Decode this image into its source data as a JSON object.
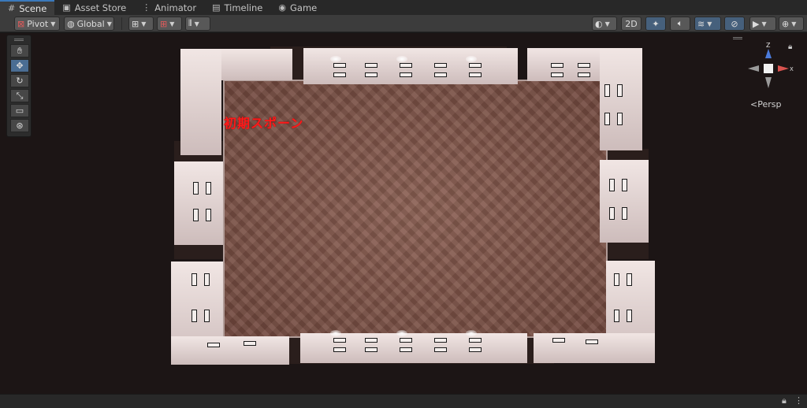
{
  "tabs": [
    {
      "label": "Scene",
      "icon": "grid-icon",
      "active": true
    },
    {
      "label": "Asset Store",
      "icon": "store-icon",
      "active": false
    },
    {
      "label": "Animator",
      "icon": "animator-icon",
      "active": false
    },
    {
      "label": "Timeline",
      "icon": "timeline-icon",
      "active": false
    },
    {
      "label": "Game",
      "icon": "gamepad-icon",
      "active": false
    }
  ],
  "toolbar": {
    "pivot": "Pivot",
    "global": "Global",
    "mode_2d": "2D"
  },
  "scene": {
    "spawn_label": "初期スポーン",
    "projection": "Persp",
    "gizmo_axes": {
      "y": "Z",
      "x": "X"
    }
  },
  "colors": {
    "accent": "#3a79bb",
    "spawn_text": "#ff1a1a",
    "gizmo_z": "#4b7bdc",
    "gizmo_x": "#d9534f"
  }
}
